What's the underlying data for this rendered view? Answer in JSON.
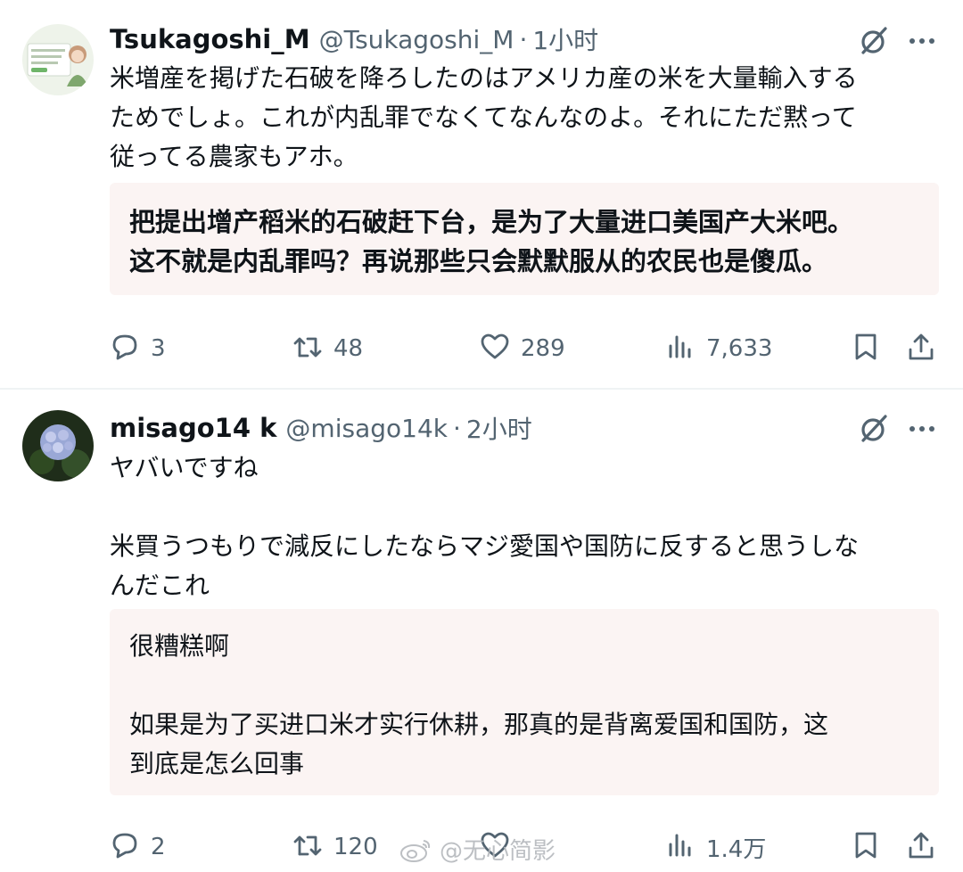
{
  "colors": {
    "text": "#0f1419",
    "secondary": "#536471",
    "translation_bg": "#fbf4f3",
    "divider": "#eff3f4"
  },
  "tweets": [
    {
      "display_name": "Tsukagoshi_M",
      "handle": "@Tsukagoshi_M",
      "separator": "·",
      "time": "1小时",
      "text": "米増産を掲げた石破を降ろしたのはアメリカ産の米を大量輸入する\nためでしょ。これが内乱罪でなくてなんなのよ。それにただ黙って\n従ってる農家もアホ。",
      "translation": "把提出增产稻米的石破赶下台，是为了大量进口美国产大米吧。\n这不就是内乱罪吗？再说那些只会默默服从的农民也是傻瓜。",
      "replies": "3",
      "reposts": "48",
      "likes": "289",
      "views": "7,633",
      "icons": [
        "grok-icon",
        "more-icon",
        "reply-icon",
        "repost-icon",
        "like-icon",
        "views-icon",
        "bookmark-icon",
        "share-icon"
      ]
    },
    {
      "display_name": "misago14 k",
      "handle": "@misago14k",
      "separator": "·",
      "time": "2小时",
      "text": "ヤバいですね\n\n米買うつもりで減反にしたならマジ愛国や国防に反すると思うしな\nんだこれ",
      "translation": "很糟糕啊\n\n如果是为了买进口米才实行休耕，那真的是背离爱国和国防，这\n到底是怎么回事",
      "replies": "2",
      "reposts": "120",
      "likes": "",
      "views": "1.4万",
      "icons": [
        "grok-icon",
        "more-icon",
        "reply-icon",
        "repost-icon",
        "like-icon",
        "views-icon",
        "bookmark-icon",
        "share-icon"
      ]
    }
  ],
  "watermark": "@无心简影"
}
